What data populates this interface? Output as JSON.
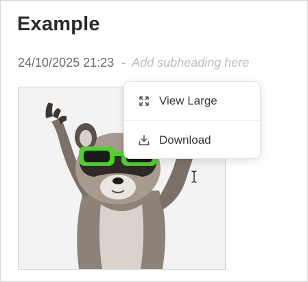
{
  "page": {
    "title": "Example",
    "timestamp": "24/10/2025 21:23",
    "separator": "-",
    "subheading_placeholder": "Add subheading here"
  },
  "image": {
    "alt": "raccoon with green sunglasses",
    "icon": "raccoon-image"
  },
  "context_menu": {
    "items": [
      {
        "label": "View Large",
        "icon": "expand-icon"
      },
      {
        "label": "Download",
        "icon": "download-icon"
      }
    ]
  },
  "colors": {
    "title": "#2b2b2b",
    "timestamp": "#6b6b6b",
    "placeholder": "#b9bcc2",
    "menu_text": "#3a3a3a",
    "sunglasses": "#4cd32a"
  }
}
